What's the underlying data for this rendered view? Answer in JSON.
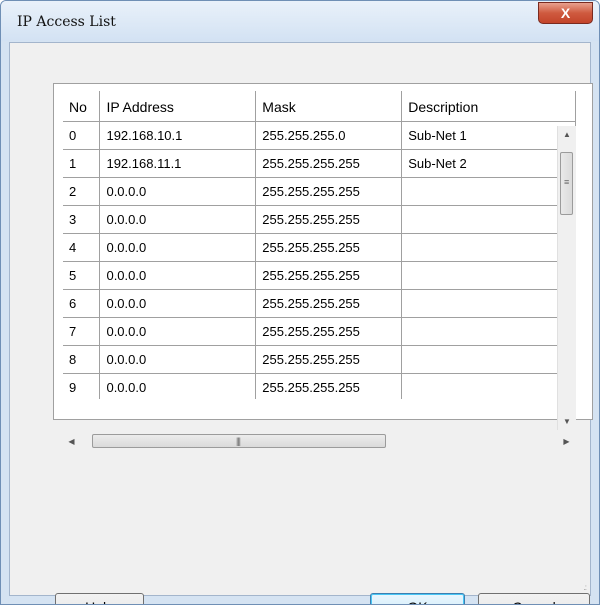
{
  "window": {
    "title": "IP Access List",
    "close_label": "X"
  },
  "table": {
    "columns": [
      "No",
      "IP Address",
      "Mask",
      "Description"
    ],
    "rows": [
      [
        "0",
        "192.168.10.1",
        "255.255.255.0",
        "Sub-Net 1"
      ],
      [
        "1",
        "192.168.11.1",
        "255.255.255.255",
        "Sub-Net 2"
      ],
      [
        "2",
        "0.0.0.0",
        "255.255.255.255",
        ""
      ],
      [
        "3",
        "0.0.0.0",
        "255.255.255.255",
        ""
      ],
      [
        "4",
        "0.0.0.0",
        "255.255.255.255",
        ""
      ],
      [
        "5",
        "0.0.0.0",
        "255.255.255.255",
        ""
      ],
      [
        "6",
        "0.0.0.0",
        "255.255.255.255",
        ""
      ],
      [
        "7",
        "0.0.0.0",
        "255.255.255.255",
        ""
      ],
      [
        "8",
        "0.0.0.0",
        "255.255.255.255",
        ""
      ],
      [
        "9",
        "0.0.0.0",
        "255.255.255.255",
        ""
      ]
    ]
  },
  "icons": {
    "close": "close-icon",
    "scroll_up": "scroll-up-arrow-icon",
    "scroll_down": "scroll-down-arrow-icon",
    "scroll_left": "scroll-left-arrow-icon",
    "scroll_right": "scroll-right-arrow-icon"
  },
  "buttons": {
    "help": "Help",
    "ok": "OK",
    "cancel": "Cancel"
  }
}
